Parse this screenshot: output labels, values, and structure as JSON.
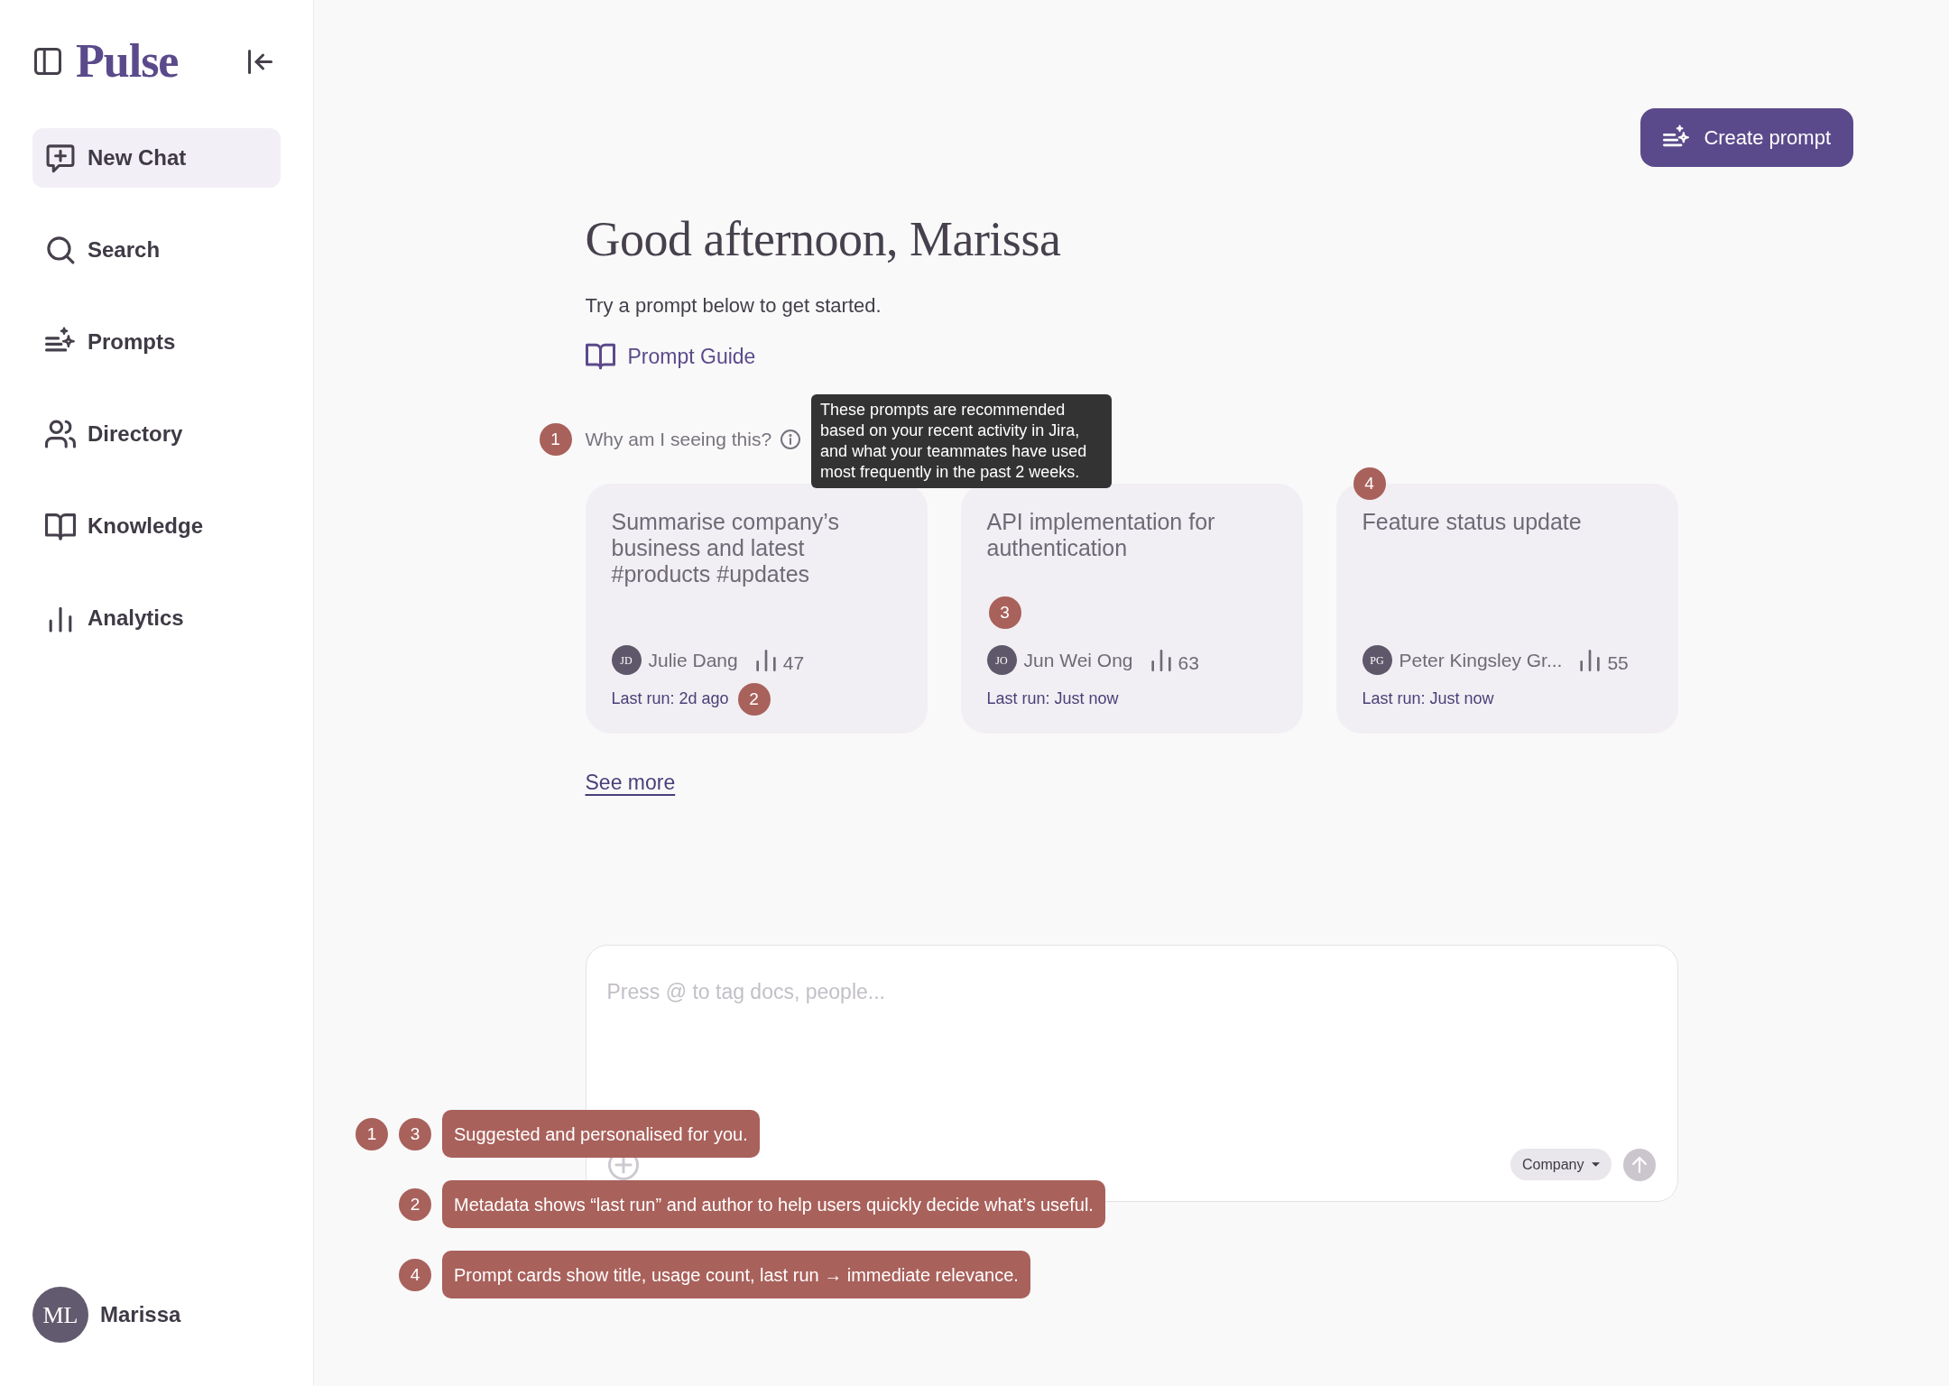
{
  "sidebar": {
    "logo": "Pulse",
    "nav": [
      {
        "label": "New Chat",
        "selected": true
      },
      {
        "label": "Search",
        "selected": false
      },
      {
        "label": "Prompts",
        "selected": false
      },
      {
        "label": "Directory",
        "selected": false
      },
      {
        "label": "Knowledge",
        "selected": false
      },
      {
        "label": "Analytics",
        "selected": false
      }
    ],
    "user": {
      "initials": "ML",
      "name": "Marissa"
    }
  },
  "header": {
    "create_button": "Create prompt"
  },
  "greeting": {
    "title": "Good afternoon, Marissa",
    "subtitle": "Try a prompt below to get started.",
    "guide_link": "Prompt Guide"
  },
  "why": {
    "text": "Why am I seeing this?",
    "marker": "1",
    "tooltip": "These prompts are recommended based on your recent activity in Jira, and what your teammates have used most frequently in the past 2 weeks."
  },
  "cards": [
    {
      "title": "Summarise company’s business and latest #products #updates",
      "author_initials": "JD",
      "author": "Julie Dang",
      "count": "47",
      "last_run": "Last run: 2d ago",
      "marker": {
        "label": "2",
        "kind": "inline"
      }
    },
    {
      "title": "API implementation for authentication",
      "author_initials": "JO",
      "author": "Jun Wei Ong",
      "count": "63",
      "last_run": "Last run: Just now",
      "marker": {
        "label": "3",
        "kind": "floating"
      }
    },
    {
      "title": "Feature status update",
      "author_initials": "PG",
      "author": "Peter Kingsley Gr...",
      "count": "55",
      "last_run": "Last run: Just now",
      "marker": {
        "label": "4",
        "kind": "corner"
      }
    }
  ],
  "see_more": "See more",
  "composer": {
    "placeholder": "Press @ to tag docs, people...",
    "scope": "Company"
  },
  "notes": [
    {
      "markers": [
        "1",
        "3"
      ],
      "text": "Suggested and personalised for you."
    },
    {
      "markers": [
        "2"
      ],
      "text": "Metadata shows “last run” and author to help users quickly decide what’s useful."
    },
    {
      "markers": [
        "4"
      ],
      "text": "Prompt cards show title, usage count, last run → immediate relevance."
    }
  ]
}
